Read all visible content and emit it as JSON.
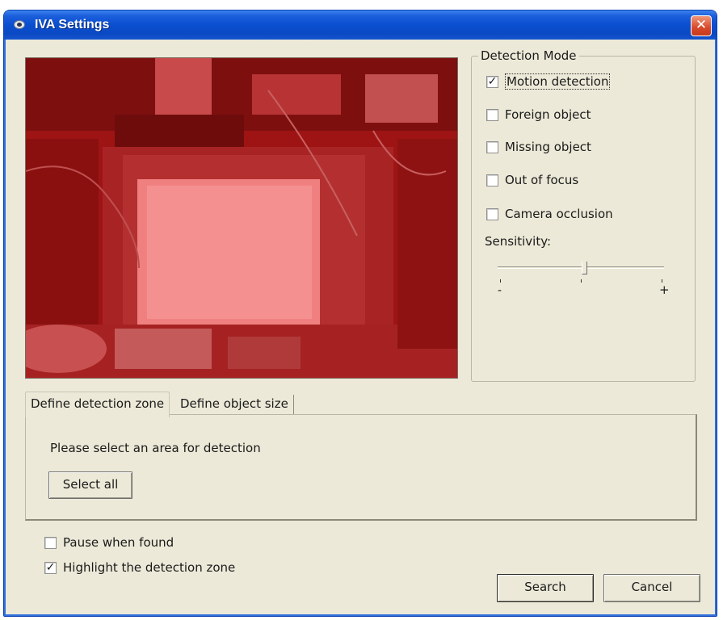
{
  "window": {
    "title": "IVA Settings",
    "close_glyph": "✕"
  },
  "detection_mode": {
    "legend": "Detection Mode",
    "options": [
      {
        "label": "Motion detection",
        "checked": true
      },
      {
        "label": "Foreign object",
        "checked": false
      },
      {
        "label": "Missing object",
        "checked": false
      },
      {
        "label": "Out of focus",
        "checked": false
      },
      {
        "label": "Camera occlusion",
        "checked": false
      }
    ],
    "sensitivity_label": "Sensitivity:",
    "sensitivity_value": 0.52,
    "min_label": "-",
    "max_label": "+"
  },
  "tabs": [
    {
      "label": "Define detection zone",
      "active": true
    },
    {
      "label": "Define object size",
      "active": false
    }
  ],
  "panel": {
    "instruction": "Please select an area for detection",
    "select_all_label": "Select all"
  },
  "options": {
    "pause_label": "Pause when found",
    "pause_checked": false,
    "highlight_label": "Highlight the detection zone",
    "highlight_checked": true
  },
  "buttons": {
    "search_label": "Search",
    "cancel_label": "Cancel"
  },
  "colors": {
    "titlebar": "#0a4fd0",
    "overlay": "#c81e1e",
    "background": "#ece9d8"
  }
}
